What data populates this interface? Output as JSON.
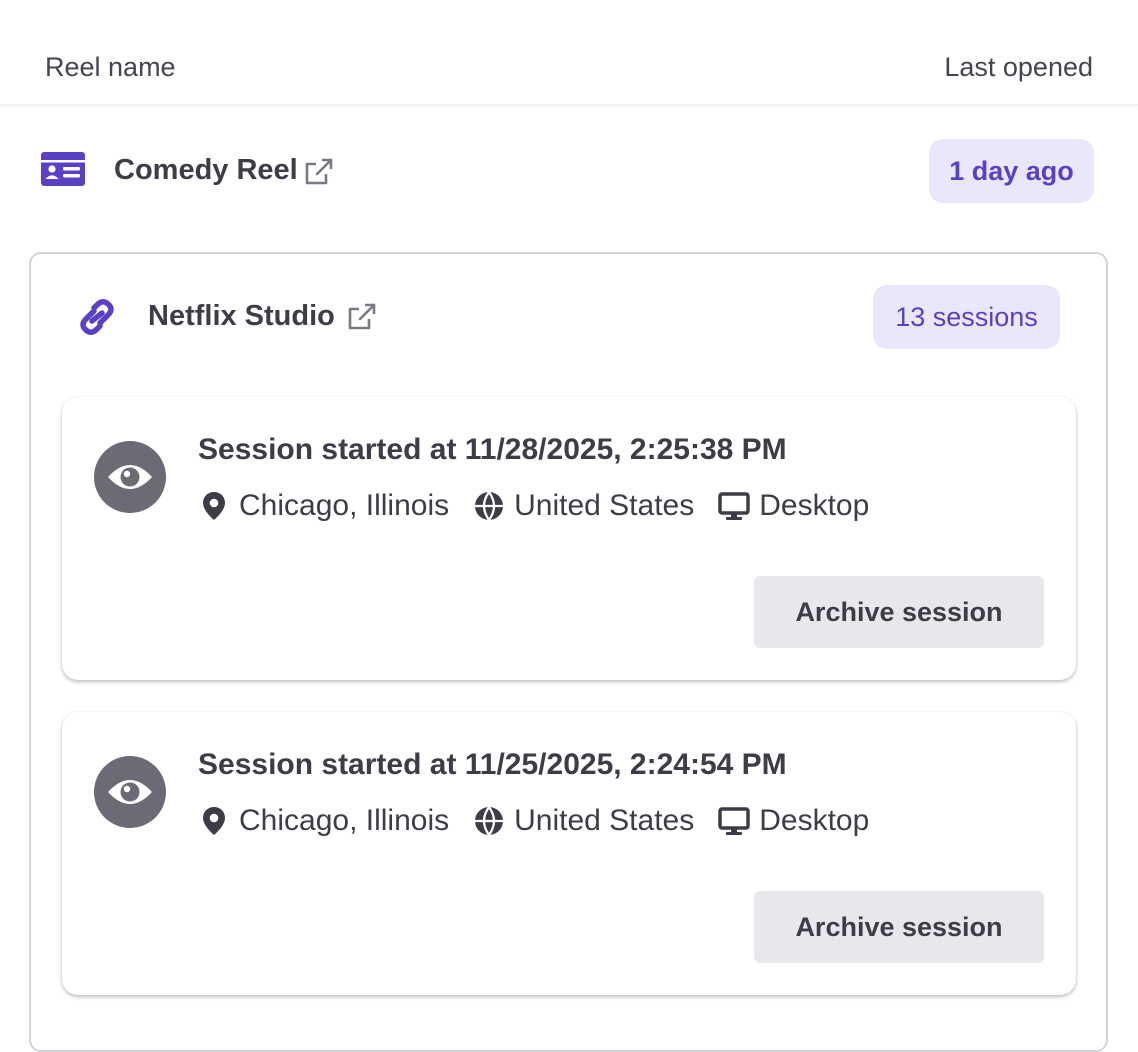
{
  "header": {
    "col_name": "Reel name",
    "col_opened": "Last opened"
  },
  "reel": {
    "title": "Comedy Reel",
    "icon": "id-card-icon",
    "last_opened": "1 day ago"
  },
  "studio": {
    "title": "Netflix Studio",
    "icon": "link-icon",
    "session_count": "13 sessions",
    "sessions": [
      {
        "title": "Session started at 11/28/2025, 2:25:38 PM",
        "city": "Chicago, Illinois",
        "country": "United States",
        "device": "Desktop",
        "archive_label": "Archive session"
      },
      {
        "title": "Session started at 11/25/2025, 2:24:54 PM",
        "city": "Chicago, Illinois",
        "country": "United States",
        "device": "Desktop",
        "archive_label": "Archive session"
      }
    ]
  },
  "colors": {
    "accent": "#5b3fc4",
    "badge_bg": "#ebe7fb",
    "icon_gray": "#6b6a75",
    "button_bg": "#e8e8ec"
  }
}
